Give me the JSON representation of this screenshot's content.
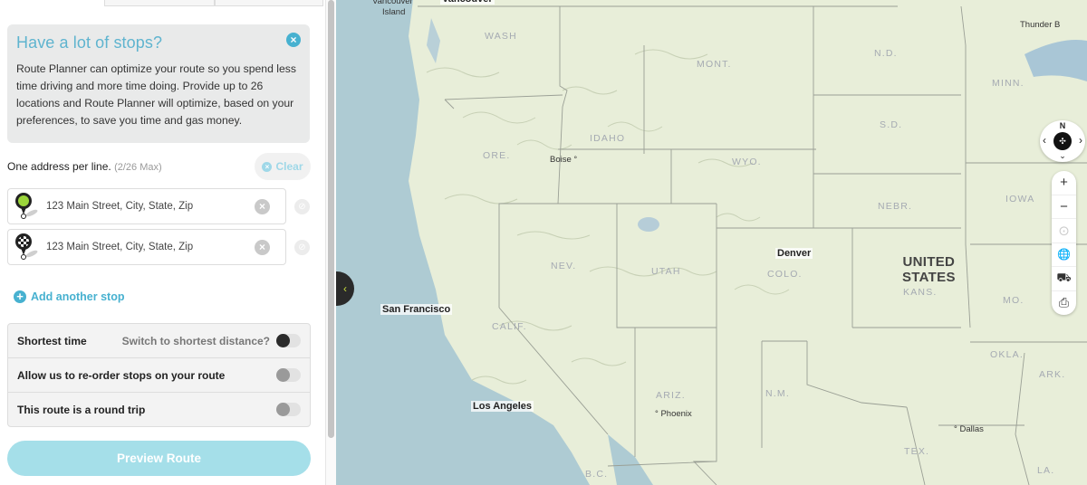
{
  "sidebar": {
    "info_card": {
      "title": "Have a lot of stops?",
      "close_icon": "×",
      "body": "Route Planner can optimize your route so you spend less time driving and more time doing. Provide up to 26 locations and Route Planner will optimize, based on your preferences, to save you time and gas money."
    },
    "address_label": "One address per line.",
    "address_count": "(2/26 Max)",
    "clear_label": "Clear",
    "clear_icon": "×",
    "stops": [
      {
        "placeholder": "123 Main Street, City, State, Zip",
        "value": "",
        "pin": "start-pin-icon",
        "clear_icon": "×",
        "link_icon": "⊘"
      },
      {
        "placeholder": "123 Main Street, City, State, Zip",
        "value": "",
        "pin": "finish-pin-icon",
        "clear_icon": "×",
        "link_icon": "⊘"
      }
    ],
    "add_stop": {
      "icon": "+",
      "label": "Add another stop"
    },
    "options": [
      {
        "label": "Shortest time",
        "hint": "Switch to shortest distance?",
        "enabled": false,
        "style": "dark"
      },
      {
        "label": "Allow us to re-order stops on your route",
        "hint": "",
        "enabled": false
      },
      {
        "label": "This route is a round trip",
        "hint": "",
        "enabled": false
      }
    ],
    "preview_button": "Preview Route"
  },
  "map": {
    "collapse_icon": "‹",
    "country": "UNITED\nSTATES",
    "country_line1": "UNITED",
    "country_line2": "STATES",
    "states": [
      "WASH",
      "ORE.",
      "IDAHO",
      "MONT.",
      "WYO.",
      "N.D.",
      "S.D.",
      "MINN.",
      "NEBR.",
      "IOWA",
      "NEV.",
      "UTAH",
      "COLO.",
      "KANS.",
      "MO.",
      "CALIF.",
      "ARIZ.",
      "N.M.",
      "OKLA.",
      "ARK.",
      "TEX.",
      "LA.",
      "B.C."
    ],
    "cities_major": [
      "Vancouver",
      "San Francisco",
      "Denver",
      "Los Angeles"
    ],
    "cities_minor": [
      "Vancouver Island",
      "Boise",
      "Phoenix",
      "Dallas",
      "Thunder B"
    ],
    "labels": {
      "vancouver": "Vancouver",
      "vancouver_island_1": "Vancouver",
      "vancouver_island_2": "Island",
      "boise": "Boise",
      "san_francisco": "San Francisco",
      "denver": "Denver",
      "los_angeles": "Los Angeles",
      "phoenix": "Phoenix",
      "dallas": "Dallas",
      "thunder_bay": "Thunder B",
      "wash": "WASH",
      "ore": "ORE.",
      "idaho": "IDAHO",
      "mont": "MONT.",
      "wyo": "WYO.",
      "nd": "N.D.",
      "sd": "S.D.",
      "minn": "MINN.",
      "nebr": "NEBR.",
      "iowa": "IOWA",
      "nev": "NEV.",
      "utah": "UTAH",
      "colo": "COLO.",
      "kans": "KANS.",
      "mo": "MO.",
      "calif": "CALIF.",
      "ariz": "ARIZ.",
      "nm": "N.M.",
      "okla": "OKLA.",
      "ark": "ARK.",
      "tex": "TEX.",
      "la": "LA.",
      "bc": "B.C."
    },
    "compass": {
      "north": "N",
      "left": "‹",
      "right": "›",
      "down": "⌄",
      "center": "✣"
    },
    "controls": [
      {
        "name": "zoom-in",
        "glyph": "+"
      },
      {
        "name": "zoom-out",
        "glyph": "−"
      },
      {
        "name": "locate",
        "glyph": "⊙"
      },
      {
        "name": "globe",
        "glyph": "🌐"
      },
      {
        "name": "traffic",
        "glyph": "⛟"
      },
      {
        "name": "print",
        "glyph": "⎙"
      }
    ]
  },
  "colors": {
    "accent": "#47b1d0",
    "preview_button": "#a5dfe9",
    "water": "#aecbd3",
    "land": "#e8eed9"
  }
}
